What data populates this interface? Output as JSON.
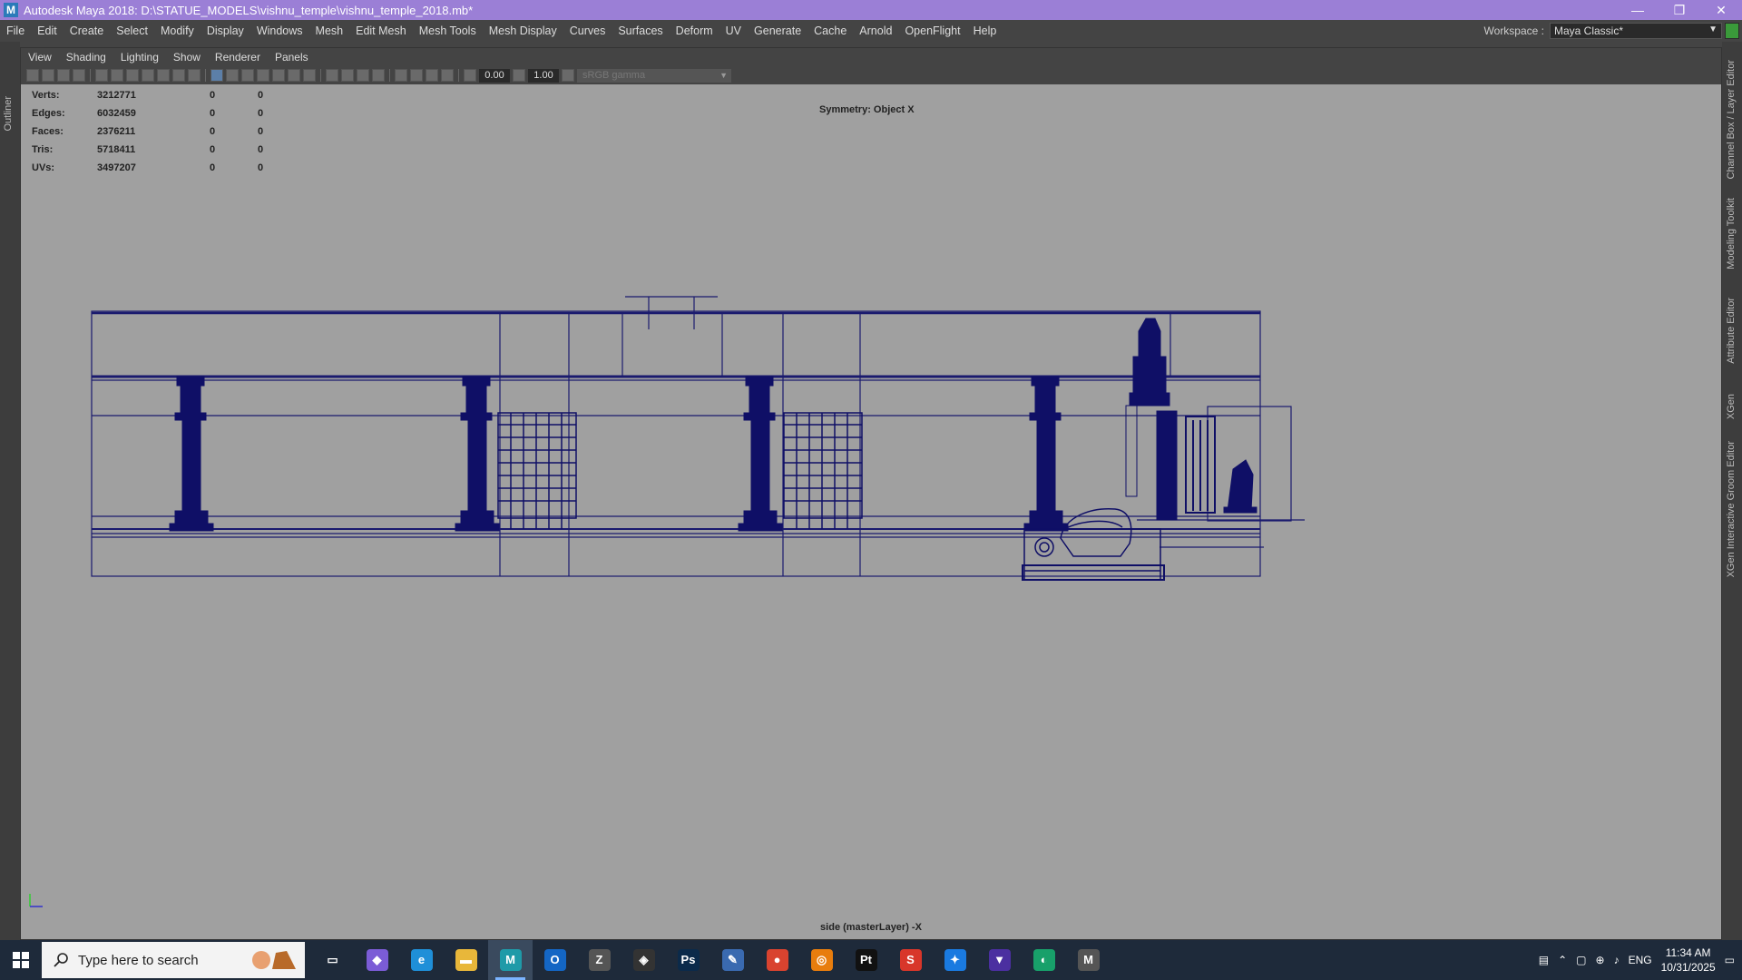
{
  "window": {
    "title": "Autodesk Maya 2018: D:\\STATUE_MODELS\\vishnu_temple\\vishnu_temple_2018.mb*",
    "logo_letter": "M",
    "minimize": "—",
    "restore": "❐",
    "close": "✕"
  },
  "menubar": {
    "items": [
      "File",
      "Edit",
      "Create",
      "Select",
      "Modify",
      "Display",
      "Windows",
      "Mesh",
      "Edit Mesh",
      "Mesh Tools",
      "Mesh Display",
      "Curves",
      "Surfaces",
      "Deform",
      "UV",
      "Generate",
      "Cache",
      "Arnold",
      "OpenFlight",
      "Help"
    ],
    "workspace_label": "Workspace :",
    "workspace_value": "Maya Classic*"
  },
  "side_tabs": {
    "left": "Outliner",
    "right": [
      "Channel Box / Layer Editor",
      "Modeling Toolkit",
      "Attribute Editor",
      "XGen",
      "XGen Interactive Groom Editor"
    ]
  },
  "panel": {
    "menu": [
      "View",
      "Shading",
      "Lighting",
      "Show",
      "Renderer",
      "Panels"
    ],
    "exposure": "0.00",
    "gamma": "1.00",
    "color_space": "sRGB gamma"
  },
  "hud": {
    "rows": [
      {
        "label": "Verts:",
        "v1": "3212771",
        "v2": "0",
        "v3": "0"
      },
      {
        "label": "Edges:",
        "v1": "6032459",
        "v2": "0",
        "v3": "0"
      },
      {
        "label": "Faces:",
        "v1": "2376211",
        "v2": "0",
        "v3": "0"
      },
      {
        "label": "Tris:",
        "v1": "5718411",
        "v2": "0",
        "v3": "0"
      },
      {
        "label": "UVs:",
        "v1": "3497207",
        "v2": "0",
        "v3": "0"
      }
    ],
    "symmetry": "Symmetry: Object X",
    "camera": "side (masterLayer) -X"
  },
  "taskbar": {
    "search_placeholder": "Type here to search",
    "apps": [
      {
        "name": "task-view",
        "glyph": "▭",
        "color": "#1e2a3a"
      },
      {
        "name": "copilot",
        "glyph": "◆",
        "color": "#7b5cd6"
      },
      {
        "name": "edge",
        "glyph": "e",
        "color": "#1f8fd8"
      },
      {
        "name": "file-explorer",
        "glyph": "▬",
        "color": "#e8b73a"
      },
      {
        "name": "maya",
        "glyph": "M",
        "color": "#1f9aa8"
      },
      {
        "name": "outlook",
        "glyph": "O",
        "color": "#1466c4"
      },
      {
        "name": "zbrush",
        "glyph": "Z",
        "color": "#555"
      },
      {
        "name": "unity",
        "glyph": "◈",
        "color": "#333"
      },
      {
        "name": "photoshop",
        "glyph": "Ps",
        "color": "#0b2a4a"
      },
      {
        "name": "krita",
        "glyph": "✎",
        "color": "#3a6ab0"
      },
      {
        "name": "chrome",
        "glyph": "●",
        "color": "#d9432f"
      },
      {
        "name": "blender",
        "glyph": "◎",
        "color": "#e87d0d"
      },
      {
        "name": "pycharm",
        "glyph": "Pt",
        "color": "#111"
      },
      {
        "name": "substance",
        "glyph": "S",
        "color": "#d8362a"
      },
      {
        "name": "app-blue",
        "glyph": "✦",
        "color": "#1a7ae0"
      },
      {
        "name": "app-shield",
        "glyph": "▼",
        "color": "#4b2fa0"
      },
      {
        "name": "app-green",
        "glyph": "◐",
        "color": "#18a06a"
      },
      {
        "name": "app-m",
        "glyph": "M",
        "color": "#555"
      }
    ],
    "lang": "ENG",
    "time": "11:34 AM",
    "date": "10/31/2025"
  }
}
